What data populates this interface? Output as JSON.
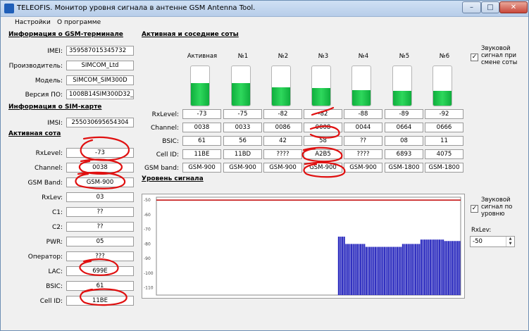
{
  "window": {
    "title": "TELEOFIS. Монитор уровня сигнала в антенне GSM Antenna Tool."
  },
  "menu": [
    "Настройки",
    "О программе"
  ],
  "gsm_terminal": {
    "title": "Информация о GSM-терминале",
    "rows": [
      {
        "label": "IMEI:",
        "value": "359587015345732"
      },
      {
        "label": "Производитель:",
        "value": "SIMCOM_Ltd"
      },
      {
        "label": "Модель:",
        "value": "SIMCOM_SIM300D"
      },
      {
        "label": "Версия ПО:",
        "value": "1008B14SIM300D32_"
      }
    ]
  },
  "sim": {
    "title": "Информация о SIM-карте",
    "rows": [
      {
        "label": "IMSI:",
        "value": "255030695654304"
      }
    ]
  },
  "active_cell": {
    "title": "Активная сота",
    "rows": [
      {
        "label": "RxLevel:",
        "value": "-73"
      },
      {
        "label": "Channel:",
        "value": "0038"
      },
      {
        "label": "GSM Band:",
        "value": "GSM-900"
      },
      {
        "label": "RxLev:",
        "value": "03"
      },
      {
        "label": "C1:",
        "value": "??"
      },
      {
        "label": "C2:",
        "value": "??"
      },
      {
        "label": "PWR:",
        "value": "05"
      },
      {
        "label": "Оператор:",
        "value": "???"
      },
      {
        "label": "LAC:",
        "value": "699E"
      },
      {
        "label": "BSIC:",
        "value": "61"
      },
      {
        "label": "Cell ID:",
        "value": "11BE"
      }
    ]
  },
  "neighbor_cells": {
    "title": "Активная и соседние соты",
    "columns": [
      "Активная",
      "№1",
      "№2",
      "№3",
      "№4",
      "№5",
      "№6"
    ],
    "signal_fill": [
      0.58,
      0.57,
      0.47,
      0.45,
      0.39,
      0.38,
      0.37
    ],
    "row_labels": [
      "RxLevel:",
      "Channel:",
      "BSIC:",
      "Cell ID:",
      "GSM band:"
    ],
    "rows": [
      [
        "-73",
        "-75",
        "-82",
        "-82",
        "-88",
        "-89",
        "-92"
      ],
      [
        "0038",
        "0033",
        "0086",
        "0008",
        "0044",
        "0664",
        "0666"
      ],
      [
        "61",
        "56",
        "42",
        "58",
        "??",
        "08",
        "11"
      ],
      [
        "11BE",
        "11BD",
        "????",
        "A2B5",
        "????",
        "6893",
        "4075"
      ],
      [
        "GSM-900",
        "GSM-900",
        "GSM-900",
        "GSM-900",
        "GSM-900",
        "GSM-1800",
        "GSM-1800"
      ]
    ]
  },
  "signal_level": {
    "title": "Уровень сигнала"
  },
  "options": {
    "sound_cell_change": "Звуковой сигнал при смене соты",
    "sound_by_level": "Звуковой сигнал по уровню",
    "rxlev_label": "RxLev:",
    "rxlev_value": "-50"
  },
  "colors": {
    "bar": "#3030c0",
    "threshold": "#c00000",
    "signal_fill": "#22c84a",
    "annotation": "#e01010"
  },
  "chart_data": {
    "type": "bar",
    "title": "",
    "xlabel": "",
    "ylabel": "",
    "ylim": [
      -115,
      -48
    ],
    "yticks": [
      -50,
      -60,
      -70,
      -80,
      -90,
      -100,
      -110
    ],
    "threshold": -50,
    "values": [
      -75,
      -75,
      -75,
      -75,
      -80,
      -80,
      -80,
      -80,
      -80,
      -80,
      -80,
      -80,
      -80,
      -80,
      -80,
      -82,
      -82,
      -82,
      -82,
      -82,
      -82,
      -82,
      -82,
      -82,
      -82,
      -82,
      -82,
      -82,
      -82,
      -82,
      -82,
      -82,
      -82,
      -82,
      -82,
      -80,
      -80,
      -80,
      -80,
      -80,
      -80,
      -80,
      -80,
      -80,
      -80,
      -77,
      -77,
      -77,
      -77,
      -77,
      -77,
      -77,
      -77,
      -77,
      -77,
      -77,
      -77,
      -77,
      -78,
      -78,
      -78,
      -78,
      -78,
      -78,
      -78,
      -78,
      -78
    ]
  }
}
